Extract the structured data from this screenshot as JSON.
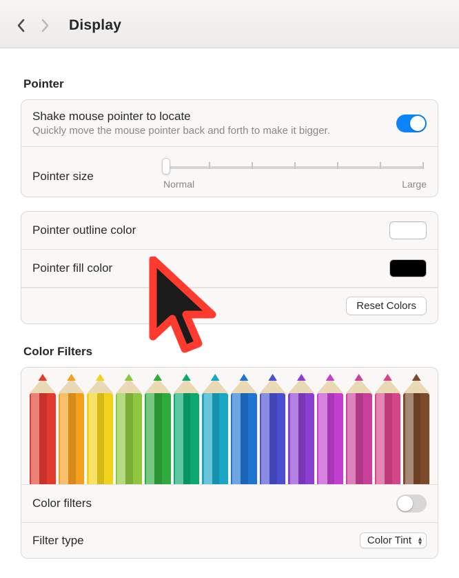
{
  "header": {
    "title": "Display"
  },
  "pointer": {
    "section_title": "Pointer",
    "shake": {
      "label": "Shake mouse pointer to locate",
      "sub": "Quickly move the mouse pointer back and forth to make it bigger.",
      "enabled": true
    },
    "size": {
      "label": "Pointer size",
      "min_caption": "Normal",
      "max_caption": "Large",
      "tick_count": 7,
      "value_index": 0
    },
    "outline": {
      "label": "Pointer outline color",
      "color": "#ffffff"
    },
    "fill": {
      "label": "Pointer fill color",
      "color": "#000000"
    },
    "reset_btn": "Reset Colors",
    "preview": {
      "outline_color": "#ff3b30",
      "fill_color": "#1b1b1b"
    }
  },
  "color_filters": {
    "section_title": "Color Filters",
    "pencil_colors": [
      "#e23b2e",
      "#f59f1e",
      "#f2d21a",
      "#8ec63f",
      "#2faa3c",
      "#0aa96f",
      "#1aa7c5",
      "#1f74d1",
      "#4a4fd1",
      "#8a3fd1",
      "#c23fcf",
      "#c9409a",
      "#d6458a",
      "#7a4a2b"
    ],
    "enabled_label": "Color filters",
    "enabled": false,
    "filter_type": {
      "label": "Filter type",
      "value": "Color Tint"
    }
  }
}
